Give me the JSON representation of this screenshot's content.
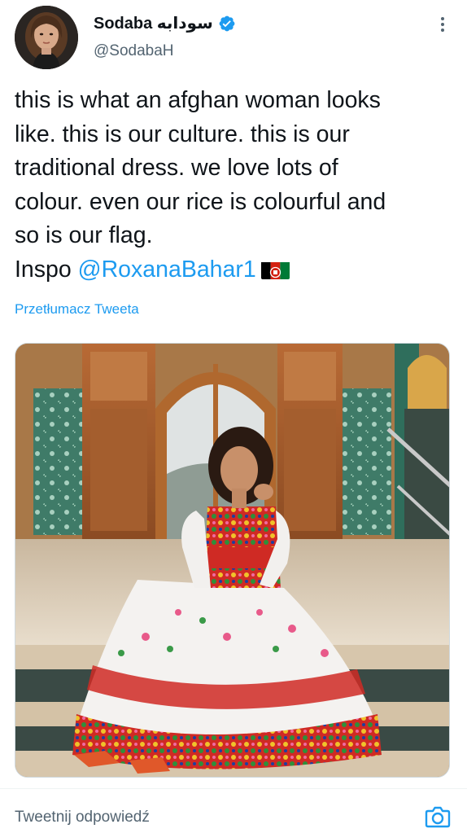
{
  "tweet": {
    "display_name": "Sodaba سودابه",
    "handle": "@SodabaH",
    "text_lines": [
      "this is what an afghan woman looks",
      "like. this is our culture. this is our",
      "traditional dress. we love lots of",
      "colour. even our rice is colourful and",
      "so is our flag."
    ],
    "inspo_label": "Inspo",
    "mention": "@RoxanaBahar1",
    "translate_label": "Przetłumacz Tweeta"
  },
  "icons": {
    "verified": "verified-badge-icon",
    "more": "more-vertical-icon",
    "flag": "afghanistan-flag-emoji",
    "camera": "camera-icon"
  },
  "reply": {
    "placeholder": "Tweetnij odpowiedź"
  },
  "colors": {
    "accent": "#1d9bf0",
    "text": "#0f1419",
    "secondary_text": "#536471",
    "divider": "#eff3f4"
  }
}
